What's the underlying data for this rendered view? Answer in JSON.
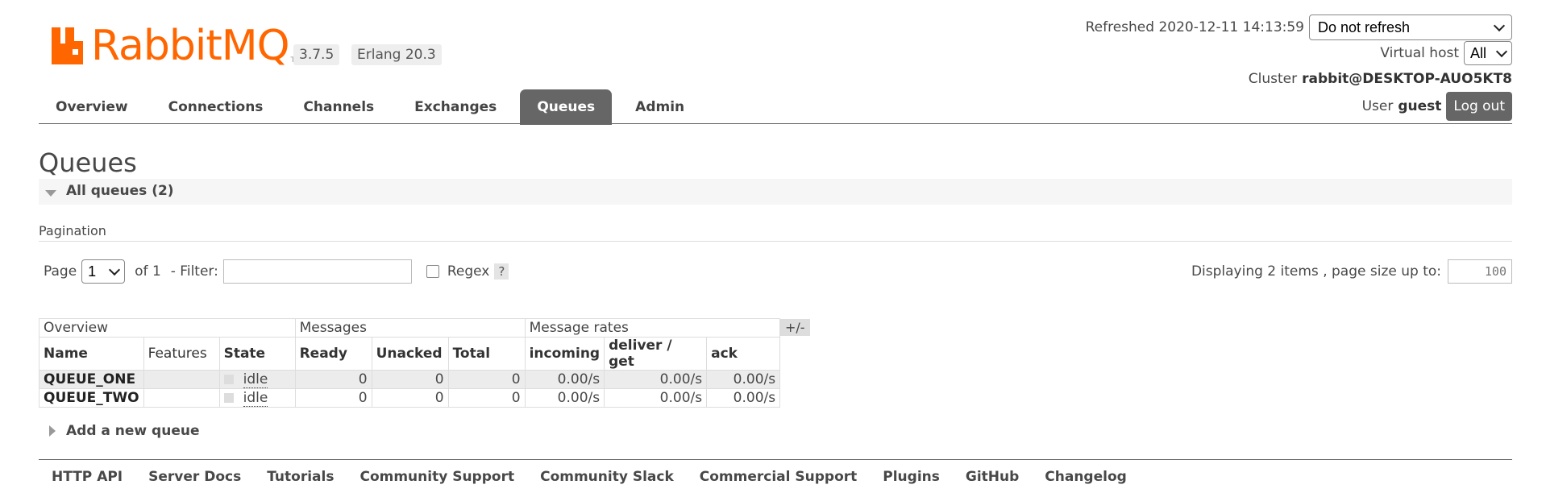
{
  "app": {
    "logo_text": "RabbitMQ",
    "logo_color": "#f60",
    "version": "3.7.5",
    "erlang": "Erlang 20.3"
  },
  "top_right": {
    "refreshed_label": "Refreshed 2020-12-11 14:13:59",
    "refresh_select": "Do not refresh",
    "vhost_label": "Virtual host",
    "vhost_select": "All",
    "cluster_label": "Cluster",
    "cluster_value": "rabbit@DESKTOP-AUO5KT8",
    "user_label": "User",
    "user_value": "guest",
    "logout": "Log out"
  },
  "nav": {
    "tabs": [
      "Overview",
      "Connections",
      "Channels",
      "Exchanges",
      "Queues",
      "Admin"
    ],
    "active": "Queues"
  },
  "page": {
    "title": "Queues",
    "all_queues": "All queues (2)",
    "pagination_label": "Pagination",
    "page_label": "Page",
    "page_value": "1",
    "of_label": "of 1",
    "filter_label": "- Filter:",
    "filter_value": "",
    "regex_label": "Regex",
    "regex_help": "?",
    "displaying": "Displaying 2 items , page size up to:",
    "page_size": "100",
    "plus_minus": "+/-",
    "add_queue": "Add a new queue"
  },
  "table": {
    "groups": [
      "Overview",
      "Messages",
      "Message rates"
    ],
    "columns": [
      "Name",
      "Features",
      "State",
      "Ready",
      "Unacked",
      "Total",
      "incoming",
      "deliver / get",
      "ack"
    ],
    "rows": [
      {
        "name": "QUEUE_ONE",
        "features": "",
        "state": "idle",
        "ready": "0",
        "unacked": "0",
        "total": "0",
        "incoming": "0.00/s",
        "deliver": "0.00/s",
        "ack": "0.00/s"
      },
      {
        "name": "QUEUE_TWO",
        "features": "",
        "state": "idle",
        "ready": "0",
        "unacked": "0",
        "total": "0",
        "incoming": "0.00/s",
        "deliver": "0.00/s",
        "ack": "0.00/s"
      }
    ]
  },
  "footer": {
    "links": [
      "HTTP API",
      "Server Docs",
      "Tutorials",
      "Community Support",
      "Community Slack",
      "Commercial Support",
      "Plugins",
      "GitHub",
      "Changelog"
    ]
  }
}
